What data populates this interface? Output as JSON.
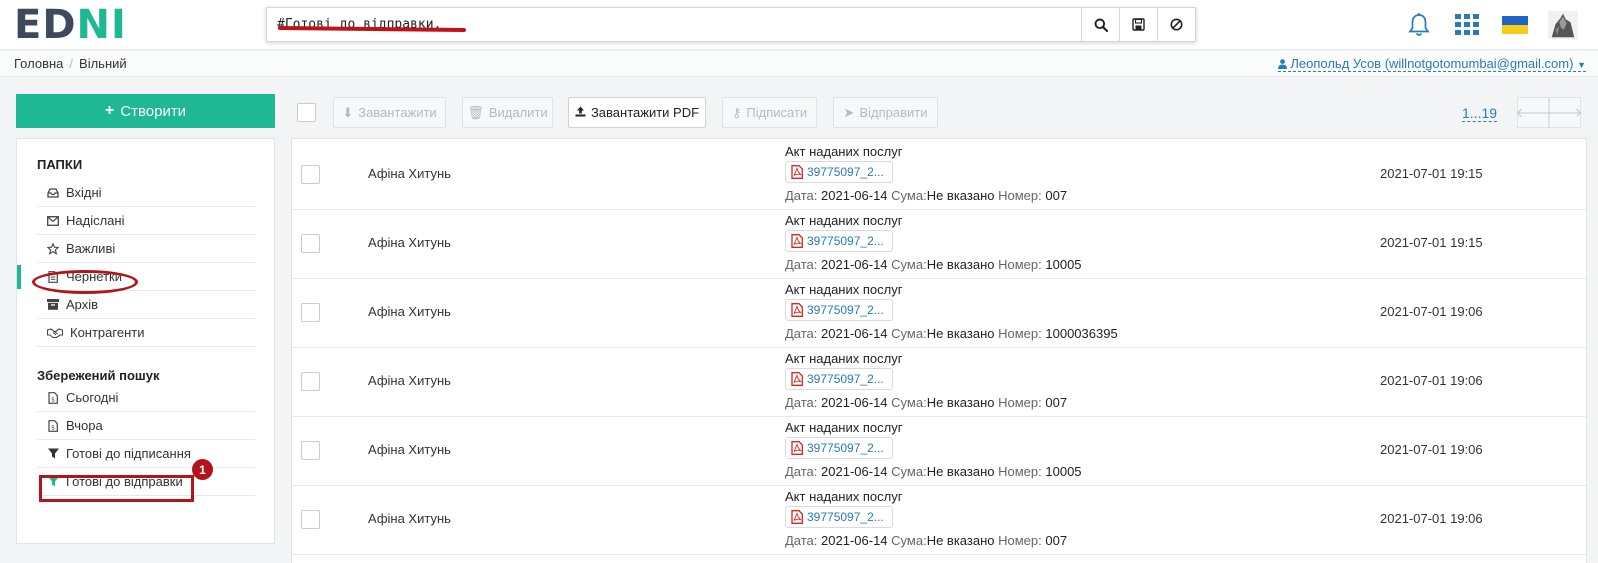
{
  "header": {
    "logo_left": "ED",
    "logo_right": "NI",
    "search_value": "#Готові до відправки,",
    "icons": [
      "search-icon",
      "save-icon",
      "clear-icon",
      "bell-icon",
      "apps-grid-icon",
      "ukraine-flag-icon",
      "user-avatar"
    ],
    "colors": {
      "brand": "#1fb894",
      "logo_dark": "#3c4a5c",
      "link": "#2a7ab8",
      "annotation": "#b3141c"
    }
  },
  "breadcrumb": {
    "home": "Головна",
    "current": "Вільний"
  },
  "user": {
    "label": "Леопольд Усов (willnotgotomumbai@gmail.com)"
  },
  "sidebar": {
    "create_label": "Створити",
    "folders_title": "ПАПКИ",
    "folders": [
      {
        "label": "Вхідні",
        "icon": "inbox-icon"
      },
      {
        "label": "Надіслані",
        "icon": "envelope-icon"
      },
      {
        "label": "Важливі",
        "icon": "star-icon"
      },
      {
        "label": "Чернетки",
        "icon": "file-icon",
        "active": true
      },
      {
        "label": "Архів",
        "icon": "archive-icon"
      },
      {
        "label": "Контрагенти",
        "icon": "handshake-icon"
      }
    ],
    "saved_title": "Збережений пошук",
    "saved": [
      {
        "label": "Сьогодні",
        "icon": "doc-icon"
      },
      {
        "label": "Вчора",
        "icon": "doc-icon"
      },
      {
        "label": "Готові до підписання",
        "icon": "filter-icon"
      },
      {
        "label": "Готові до відправки",
        "icon": "filter-icon",
        "highlighted": true
      }
    ],
    "annotation_badge": "1"
  },
  "toolbar": {
    "download": "Завантажити",
    "delete": "Видалити",
    "upload_pdf": "Завантажити PDF",
    "sign": "Підписати",
    "send": "Відправити",
    "page_range": "1...19"
  },
  "documents": [
    {
      "partner": "Афіна Хитунь",
      "title": "Акт наданих послуг",
      "file": "39775097_2...",
      "date_label": "Дата:",
      "date": "2021-06-14",
      "sum_label": "Сума:",
      "sum": "Не вказано",
      "number_label": "Номер:",
      "number": "007",
      "timestamp": "2021-07-01 19:15"
    },
    {
      "partner": "Афіна Хитунь",
      "title": "Акт наданих послуг",
      "file": "39775097_2...",
      "date_label": "Дата:",
      "date": "2021-06-14",
      "sum_label": "Сума:",
      "sum": "Не вказано",
      "number_label": "Номер:",
      "number": "10005",
      "timestamp": "2021-07-01 19:15"
    },
    {
      "partner": "Афіна Хитунь",
      "title": "Акт наданих послуг",
      "file": "39775097_2...",
      "date_label": "Дата:",
      "date": "2021-06-14",
      "sum_label": "Сума:",
      "sum": "Не вказано",
      "number_label": "Номер:",
      "number": "1000036395",
      "timestamp": "2021-07-01 19:06"
    },
    {
      "partner": "Афіна Хитунь",
      "title": "Акт наданих послуг",
      "file": "39775097_2...",
      "date_label": "Дата:",
      "date": "2021-06-14",
      "sum_label": "Сума:",
      "sum": "Не вказано",
      "number_label": "Номер:",
      "number": "007",
      "timestamp": "2021-07-01 19:06"
    },
    {
      "partner": "Афіна Хитунь",
      "title": "Акт наданих послуг",
      "file": "39775097_2...",
      "date_label": "Дата:",
      "date": "2021-06-14",
      "sum_label": "Сума:",
      "sum": "Не вказано",
      "number_label": "Номер:",
      "number": "10005",
      "timestamp": "2021-07-01 19:06"
    },
    {
      "partner": "Афіна Хитунь",
      "title": "Акт наданих послуг",
      "file": "39775097_2...",
      "date_label": "Дата:",
      "date": "2021-06-14",
      "sum_label": "Сума:",
      "sum": "Не вказано",
      "number_label": "Номер:",
      "number": "007",
      "timestamp": "2021-07-01 19:06"
    }
  ]
}
